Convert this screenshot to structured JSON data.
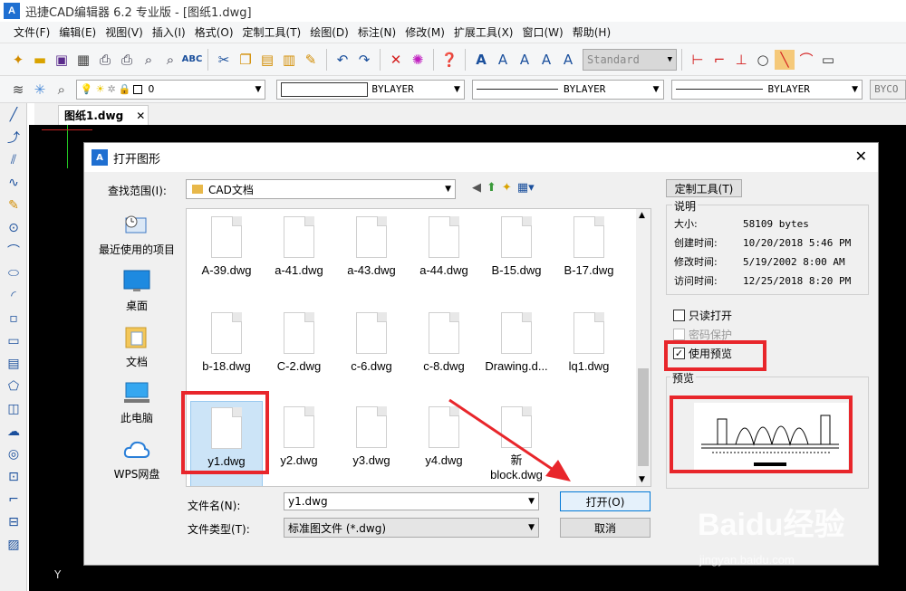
{
  "app": {
    "title": "迅捷CAD编辑器 6.2 专业版 - [图纸1.dwg]",
    "logo_text": "A"
  },
  "menu": [
    "文件(F)",
    "编辑(E)",
    "视图(V)",
    "插入(I)",
    "格式(O)",
    "定制工具(T)",
    "绘图(D)",
    "标注(N)",
    "修改(M)",
    "扩展工具(X)",
    "窗口(W)",
    "帮助(H)"
  ],
  "toolbar1": {
    "style_select": "Standard"
  },
  "toolbar2": {
    "layer": "0",
    "color": "BYLAYER",
    "linetype": "BYLAYER",
    "lineweight": "BYLAYER",
    "plot_style": "BYCO"
  },
  "tabs": [
    {
      "label": "图纸1.dwg",
      "close": "✕"
    }
  ],
  "canvas": {
    "axis_label": "Y"
  },
  "dialog": {
    "title": "打开图形",
    "close": "✕",
    "lookin_label": "查找范围(I):",
    "lookin_value": "CAD文档",
    "places": [
      {
        "label": "最近使用的项目",
        "icon": "recent-icon"
      },
      {
        "label": "桌面",
        "icon": "desktop-icon"
      },
      {
        "label": "文档",
        "icon": "documents-icon"
      },
      {
        "label": "此电脑",
        "icon": "computer-icon"
      },
      {
        "label": "WPS网盘",
        "icon": "cloud-icon"
      }
    ],
    "files": [
      {
        "name": "A-39.dwg"
      },
      {
        "name": "a-41.dwg"
      },
      {
        "name": "a-43.dwg"
      },
      {
        "name": "a-44.dwg"
      },
      {
        "name": "B-15.dwg"
      },
      {
        "name": "B-17.dwg"
      },
      {
        "name": "b-18.dwg"
      },
      {
        "name": "C-2.dwg"
      },
      {
        "name": "c-6.dwg"
      },
      {
        "name": "c-8.dwg"
      },
      {
        "name": "Drawing.d..."
      },
      {
        "name": "lq1.dwg"
      },
      {
        "name": "y1.dwg",
        "selected": true
      },
      {
        "name": "y2.dwg"
      },
      {
        "name": "y3.dwg"
      },
      {
        "name": "y4.dwg"
      },
      {
        "name": "新\nblock.dwg"
      }
    ],
    "filename_label": "文件名(N):",
    "filename_value": "y1.dwg",
    "filetype_label": "文件类型(T):",
    "filetype_value": "标准图文件 (*.dwg)",
    "open_button": "打开(O)",
    "cancel_button": "取消",
    "custom_tools_button": "定制工具(T)",
    "description": {
      "title": "说明",
      "rows": [
        {
          "key": "大小:",
          "value": "58109 bytes"
        },
        {
          "key": "创建时间:",
          "value": "10/20/2018 5:46 PM"
        },
        {
          "key": "修改时间:",
          "value": "5/19/2002 8:00 AM"
        },
        {
          "key": "访问时间:",
          "value": "12/25/2018 8:20 PM"
        }
      ]
    },
    "readonly_label": "只读打开",
    "password_label": "密码保护",
    "preview_check_label": "使用预览",
    "preview_title": "预览"
  },
  "watermark": {
    "main": "Baidu经验",
    "sub": "jingyan.baidu.com"
  },
  "colors": {
    "highlight": "#e8262b",
    "accent": "#1f6fd1"
  }
}
